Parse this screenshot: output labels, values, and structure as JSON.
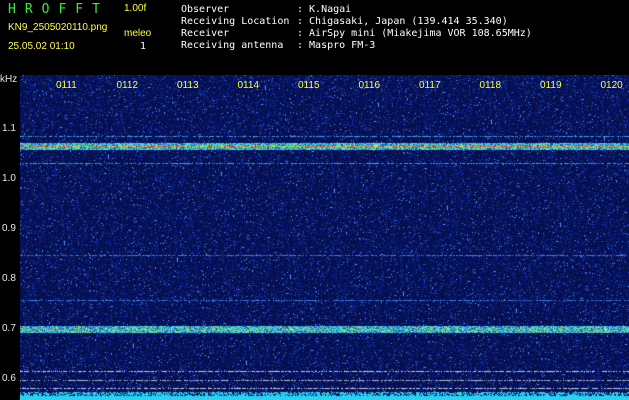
{
  "header": {
    "app_title": "HROFFT",
    "version": "1.00f",
    "filename": "KN9_2505020110.png",
    "meleo_label": "meleo",
    "datetime": "25.05.02 01:10",
    "meleo_value": "1",
    "info": [
      {
        "label": "Observer",
        "value": ": K.Nagai"
      },
      {
        "label": "Receiving Location",
        "value": ": Chigasaki, Japan (139.414 35.340)"
      },
      {
        "label": "Receiver",
        "value": ": AirSpy mini (Miakejima VOR 108.65MHz)"
      },
      {
        "label": "Receiving antenna",
        "value": ": Maspro FM-3"
      }
    ]
  },
  "spectrogram": {
    "y_unit": "kHz",
    "y_ticks": [
      "1.1",
      "1.0",
      "0.9",
      "0.8",
      "0.7",
      "0.6"
    ],
    "x_ticks": [
      "0111",
      "0112",
      "0113",
      "0114",
      "0115",
      "0116",
      "0117",
      "0118",
      "0119",
      "0120"
    ],
    "colors": {
      "background": "#06104f",
      "tick_text": "#ffff40",
      "axis_text": "#e8e8e8"
    }
  }
}
